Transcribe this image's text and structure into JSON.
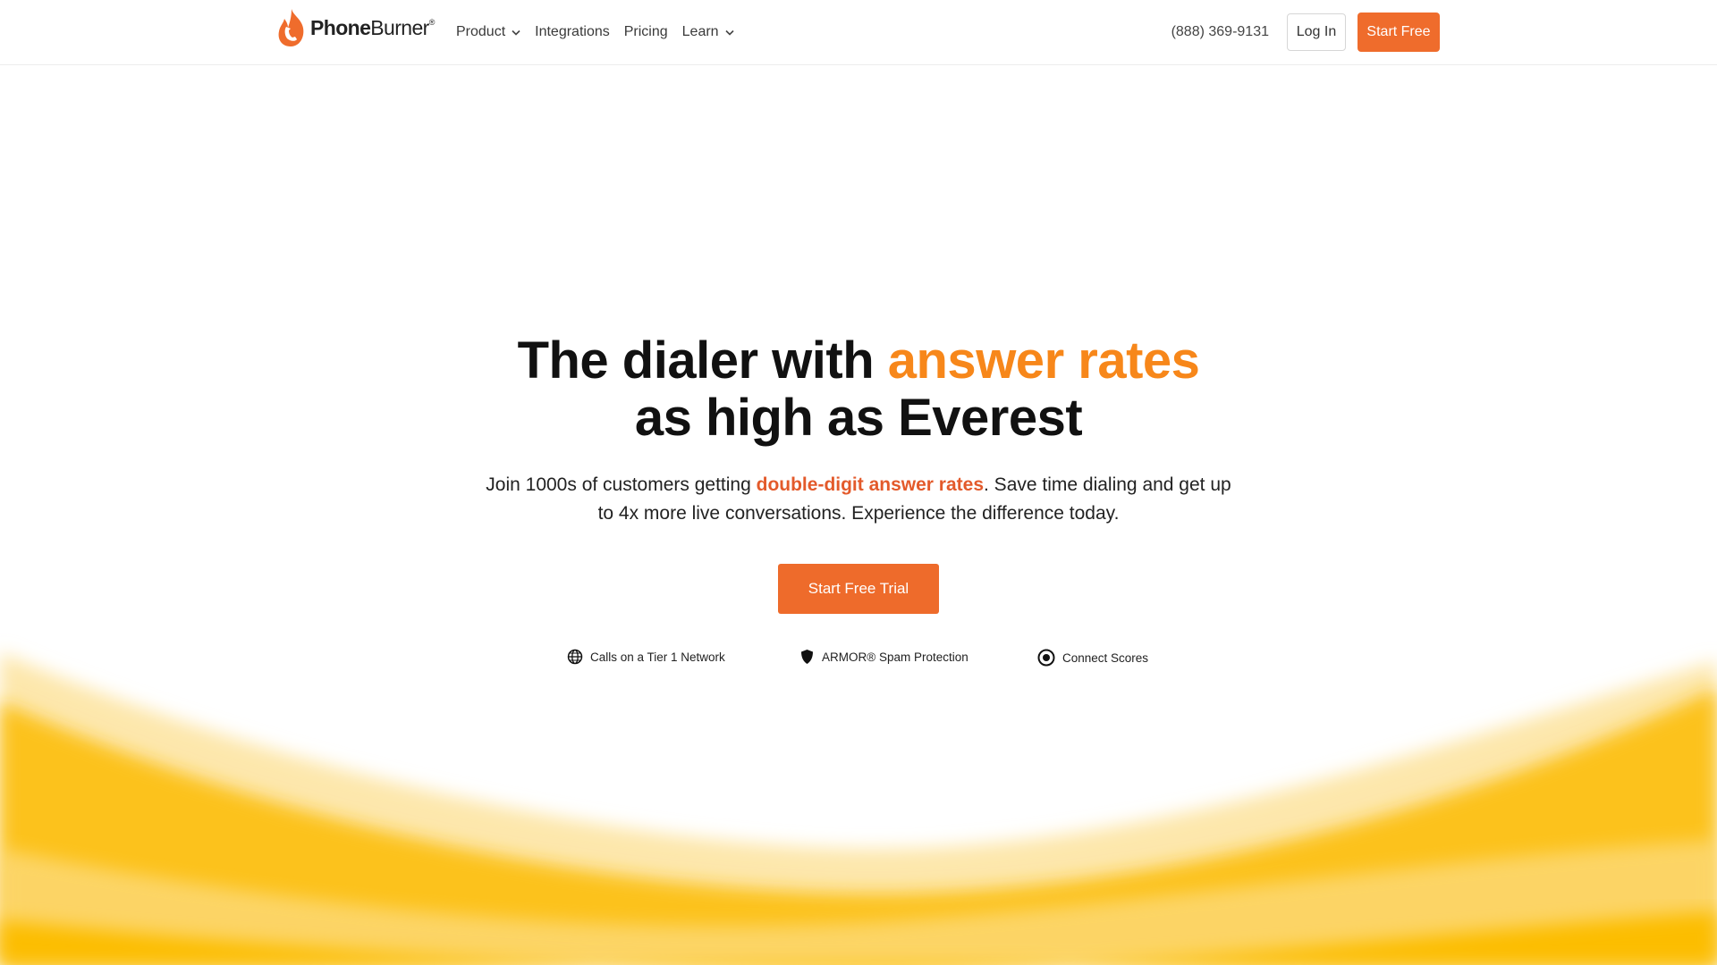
{
  "header": {
    "logo": {
      "strong": "Phone",
      "light": "Burner",
      "reg": "®"
    },
    "nav": [
      {
        "label": "Product",
        "has_dropdown": true
      },
      {
        "label": "Integrations",
        "has_dropdown": false
      },
      {
        "label": "Pricing",
        "has_dropdown": false
      },
      {
        "label": "Learn",
        "has_dropdown": true
      }
    ],
    "phone": "(888) 369-9131",
    "login_label": "Log In",
    "start_free_label": "Start Free"
  },
  "hero": {
    "title_part1": "The dialer with ",
    "title_accent": "answer rates",
    "title_line2": "as high as Everest",
    "sub_part1": "Join 1000s of customers getting ",
    "sub_highlight": "double-digit answer rates",
    "sub_part2": ". Save time dialing and get up to 4x more live conversations. Experience the difference today.",
    "cta_label": "Start Free Trial"
  },
  "features": [
    {
      "icon": "globe-icon",
      "label": "Calls on a Tier 1 Network"
    },
    {
      "icon": "shield-icon",
      "label": "ARMOR® Spam Protection"
    },
    {
      "icon": "target-icon",
      "label": "Connect Scores"
    }
  ],
  "colors": {
    "brand_orange": "#ef6c2c",
    "accent_orange": "#f7871a",
    "highlight_red": "#e35a2b",
    "wave_yellow": "#fcbd00",
    "wave_light": "#fde3a0"
  }
}
